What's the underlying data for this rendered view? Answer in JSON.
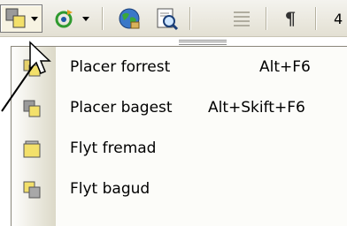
{
  "toolbar": {
    "buttons": [
      {
        "icon": "arrange-objects-icon",
        "has_dropdown": true,
        "pressed": true
      },
      {
        "icon": "rotate-free-icon",
        "has_dropdown": true,
        "pressed": false
      },
      {
        "icon": "globe-insert-icon",
        "has_dropdown": false,
        "pressed": false
      },
      {
        "icon": "document-zoom-icon",
        "has_dropdown": false,
        "pressed": false
      },
      {
        "icon": "justify-lines-icon",
        "has_dropdown": false,
        "pressed": false
      },
      {
        "icon": "paragraph-mark-icon",
        "has_dropdown": false,
        "pressed": false
      }
    ],
    "truncated_text": "4",
    "pilcrow": "¶"
  },
  "menu": {
    "items": [
      {
        "label": "Placer forrest",
        "shortcut": "Alt+F6",
        "icon": "bring-to-front-icon"
      },
      {
        "label": "Placer bagest",
        "shortcut": "Alt+Skift+F6",
        "icon": "send-to-back-icon"
      },
      {
        "label": "Flyt fremad",
        "shortcut": "",
        "icon": "bring-forward-icon"
      },
      {
        "label": "Flyt bagud",
        "shortcut": "",
        "icon": "send-backward-icon"
      }
    ]
  },
  "colors": {
    "toolbar_bg": "#e8e6dc",
    "menu_bg": "#fcfcf9",
    "icon_yellow": "#f3e06a",
    "icon_gray": "#8c8c8c"
  }
}
